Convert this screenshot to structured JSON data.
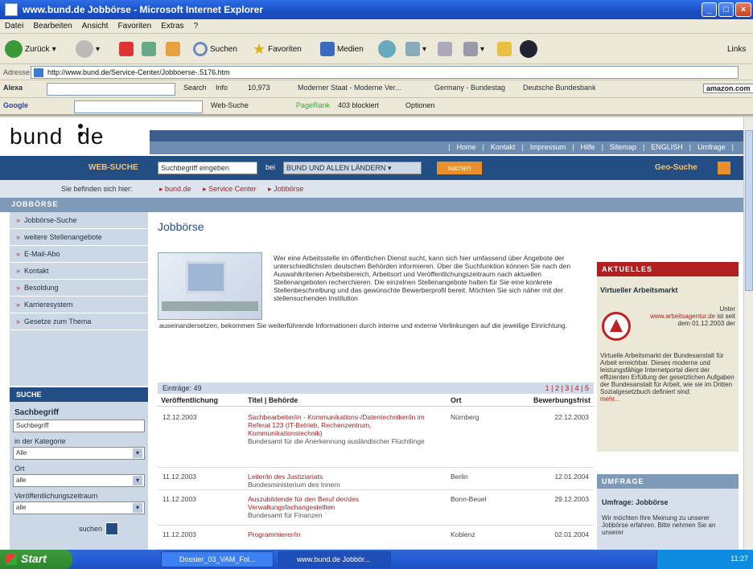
{
  "window": {
    "title": "www.bund.de Jobbörse - Microsoft Internet Explorer",
    "menu": [
      "Datei",
      "Bearbeiten",
      "Ansicht",
      "Favoriten",
      "Extras",
      "?"
    ]
  },
  "toolbar": {
    "back": "Zurück",
    "search": "Suchen",
    "favorites": "Favoriten",
    "media": "Medien",
    "links": "Links"
  },
  "address": {
    "label": "Adresse",
    "url": "http://www.bund.de/Service-Center/Jobboerse-.5176.htm"
  },
  "alexa": {
    "brand": "Alexa",
    "search": "Search",
    "info": "Info",
    "rank": "10,973",
    "related": "Moderner Staat - Moderne Ver...",
    "links": [
      "Germany - Bundestag",
      "Deutsche Bundesbank"
    ],
    "amazon": "amazon.com"
  },
  "google": {
    "brand": "Google",
    "websuche": "Web-Suche",
    "pagerank": "PageRank",
    "blocked": "403 blockiert",
    "options": "Optionen"
  },
  "site": {
    "logo_left": "bund",
    "logo_right": "de",
    "topnav": [
      "Home",
      "Kontakt",
      "Impressum",
      "Hilfe",
      "Sitemap",
      "ENGLISH",
      "Umfrage"
    ],
    "websuche_label": "WEB-SUCHE",
    "search_placeholder": "Suchbegriff eingeben",
    "bei": "bei",
    "scope": "BUND UND ALLEN LÄNDERN",
    "search_button": "suchen",
    "geo": "Geo-Suche",
    "breadcrumb_lead": "Sie befinden sich hier:",
    "breadcrumb": [
      "bund.de",
      "Service Center",
      "Jobbörse"
    ],
    "section": "JOBBÖRSE"
  },
  "leftnav": {
    "items": [
      "Jobbörse-Suche",
      "weitere Stellenangebote",
      "E-Mail-Abo",
      "Kontakt",
      "Besoldung",
      "Karrieresystem",
      "Gesetze zum Thema"
    ]
  },
  "leftsearch": {
    "title": "SUCHE",
    "sachbegriff": "Sachbegriff",
    "sach_value": "Suchbegriff",
    "kategorie": "in der Kategorie",
    "kategorie_value": "Alle",
    "ort": "Ort",
    "ort_value": "alle",
    "zeitraum": "Veröffentlichungszeitraum",
    "zeitraum_value": "alle",
    "button": "suchen"
  },
  "main": {
    "title": "Jobbörse",
    "intro": "Wer eine Arbeitsstelle im öffentlichen Dienst sucht, kann sich hier umfassend über Angebote der unterschiedlichsten deutschen Behörden informieren. Über die Suchfunktion können Sie nach den Auswahlkriterien Arbeitsbereich, Arbeitsort und Veröffentlichungszeitraum nach aktuellen Stellenangeboten recherchieren. Die einzelnen Stellenangebote halten für Sie eine konkrete Stellenbeschreibung und das gewünschte Bewerberprofil bereit. Möchten Sie sich näher mit der stellensuchenden Institution",
    "intro2": "auseinandersetzen, bekommen Sie weiterführende Informationen durch interne und externe Verlinkungen auf die jeweilige Einrichtung.",
    "entries_label": "Einträge: 49",
    "pages": "1 | 2 | 3 | 4 | 5",
    "cols": [
      "Veröffentlichung",
      "Titel | Behörde",
      "Ort",
      "Bewerbungsfrist"
    ],
    "rows": [
      {
        "date": "12.12.2003",
        "title": "Sachbearbeiter/in - Kommunikations-/Datentechniker/in im Referat 123 (IT-Betrieb, Rechenzentrum, Kommunikationstechnik)",
        "agency": "Bundesamt für die Anerkennung ausländischer Flüchtlinge",
        "ort": "Nürnberg",
        "frist": "22.12.2003"
      },
      {
        "date": "11.12.2003",
        "title": "Leiter/in des Justiziariats",
        "agency": "Bundesministerium des Innern",
        "ort": "Berlin",
        "frist": "12.01.2004"
      },
      {
        "date": "11.12.2003",
        "title": "Auszubildende für den Beruf der/des Verwaltungsfachangestellten",
        "agency": "Bundesamt für Finanzen",
        "ort": "Bonn-Beuel",
        "frist": "29.12.2003"
      },
      {
        "date": "11.12.2003",
        "title": "Programmierer/in",
        "agency": "",
        "ort": "Koblenz",
        "frist": "02.01.2004"
      }
    ]
  },
  "right": {
    "aktuell_title": "AKTUELLES",
    "aktuell_sub": "Virtueller Arbeitsmarkt",
    "aktuell_text1": "Unter",
    "aktuell_link": "www.arbeitsagentur.de",
    "aktuell_text2": "ist seit dem 01.12.2003 der",
    "aktuell_text3": "Virtuelle Arbeitsmarkt der Bundesanstalt für Arbeit erreichbar. Dieses moderne und leistungsfähige Internetportal dient der effizienten Erfüllung der gesetzlichen Aufgaben der Bundesanstalt für Arbeit, wie sie im Dritten Sozialgesetzbuch definiert sind:",
    "aktuell_more": "mehr...",
    "umfrage_title": "UMFRAGE",
    "umfrage_sub": "Umfrage: Jobbörse",
    "umfrage_text": "Wir möchten Ihre Meinung zu unserer Jobbörse erfahren. Bitte nehmen Sie an unserer"
  },
  "taskbar": {
    "start": "Start",
    "tasks": [
      "Dossier_03_VAM_Fol...",
      "www.bund.de Jobbör..."
    ],
    "clock": "11:27"
  }
}
